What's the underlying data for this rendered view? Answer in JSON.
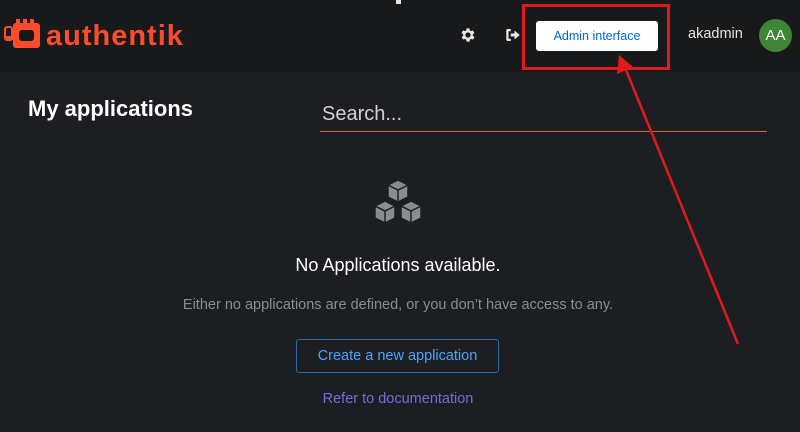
{
  "header": {
    "logo_text": "authentik",
    "settings_icon": "gear-icon",
    "logout_icon": "sign-out-icon",
    "admin_button_label": "Admin interface",
    "username": "akadmin",
    "avatar_initials": "AA"
  },
  "main": {
    "title": "My applications",
    "search": {
      "placeholder": "Search...",
      "value": ""
    },
    "empty_state": {
      "icon": "cubes-icon",
      "title": "No Applications available.",
      "body": "Either no applications are defined, or you don’t have access to any.",
      "create_button_label": "Create a new application",
      "docs_link_label": "Refer to documentation"
    }
  },
  "annotation": {
    "highlight_color": "#e01b1b",
    "target": "admin-interface-button"
  },
  "colors": {
    "brand": "#fd4b2d",
    "background": "#1c1e21",
    "header_background": "#18191b",
    "link_blue": "#4da3ff",
    "avatar": "#3e8635"
  }
}
